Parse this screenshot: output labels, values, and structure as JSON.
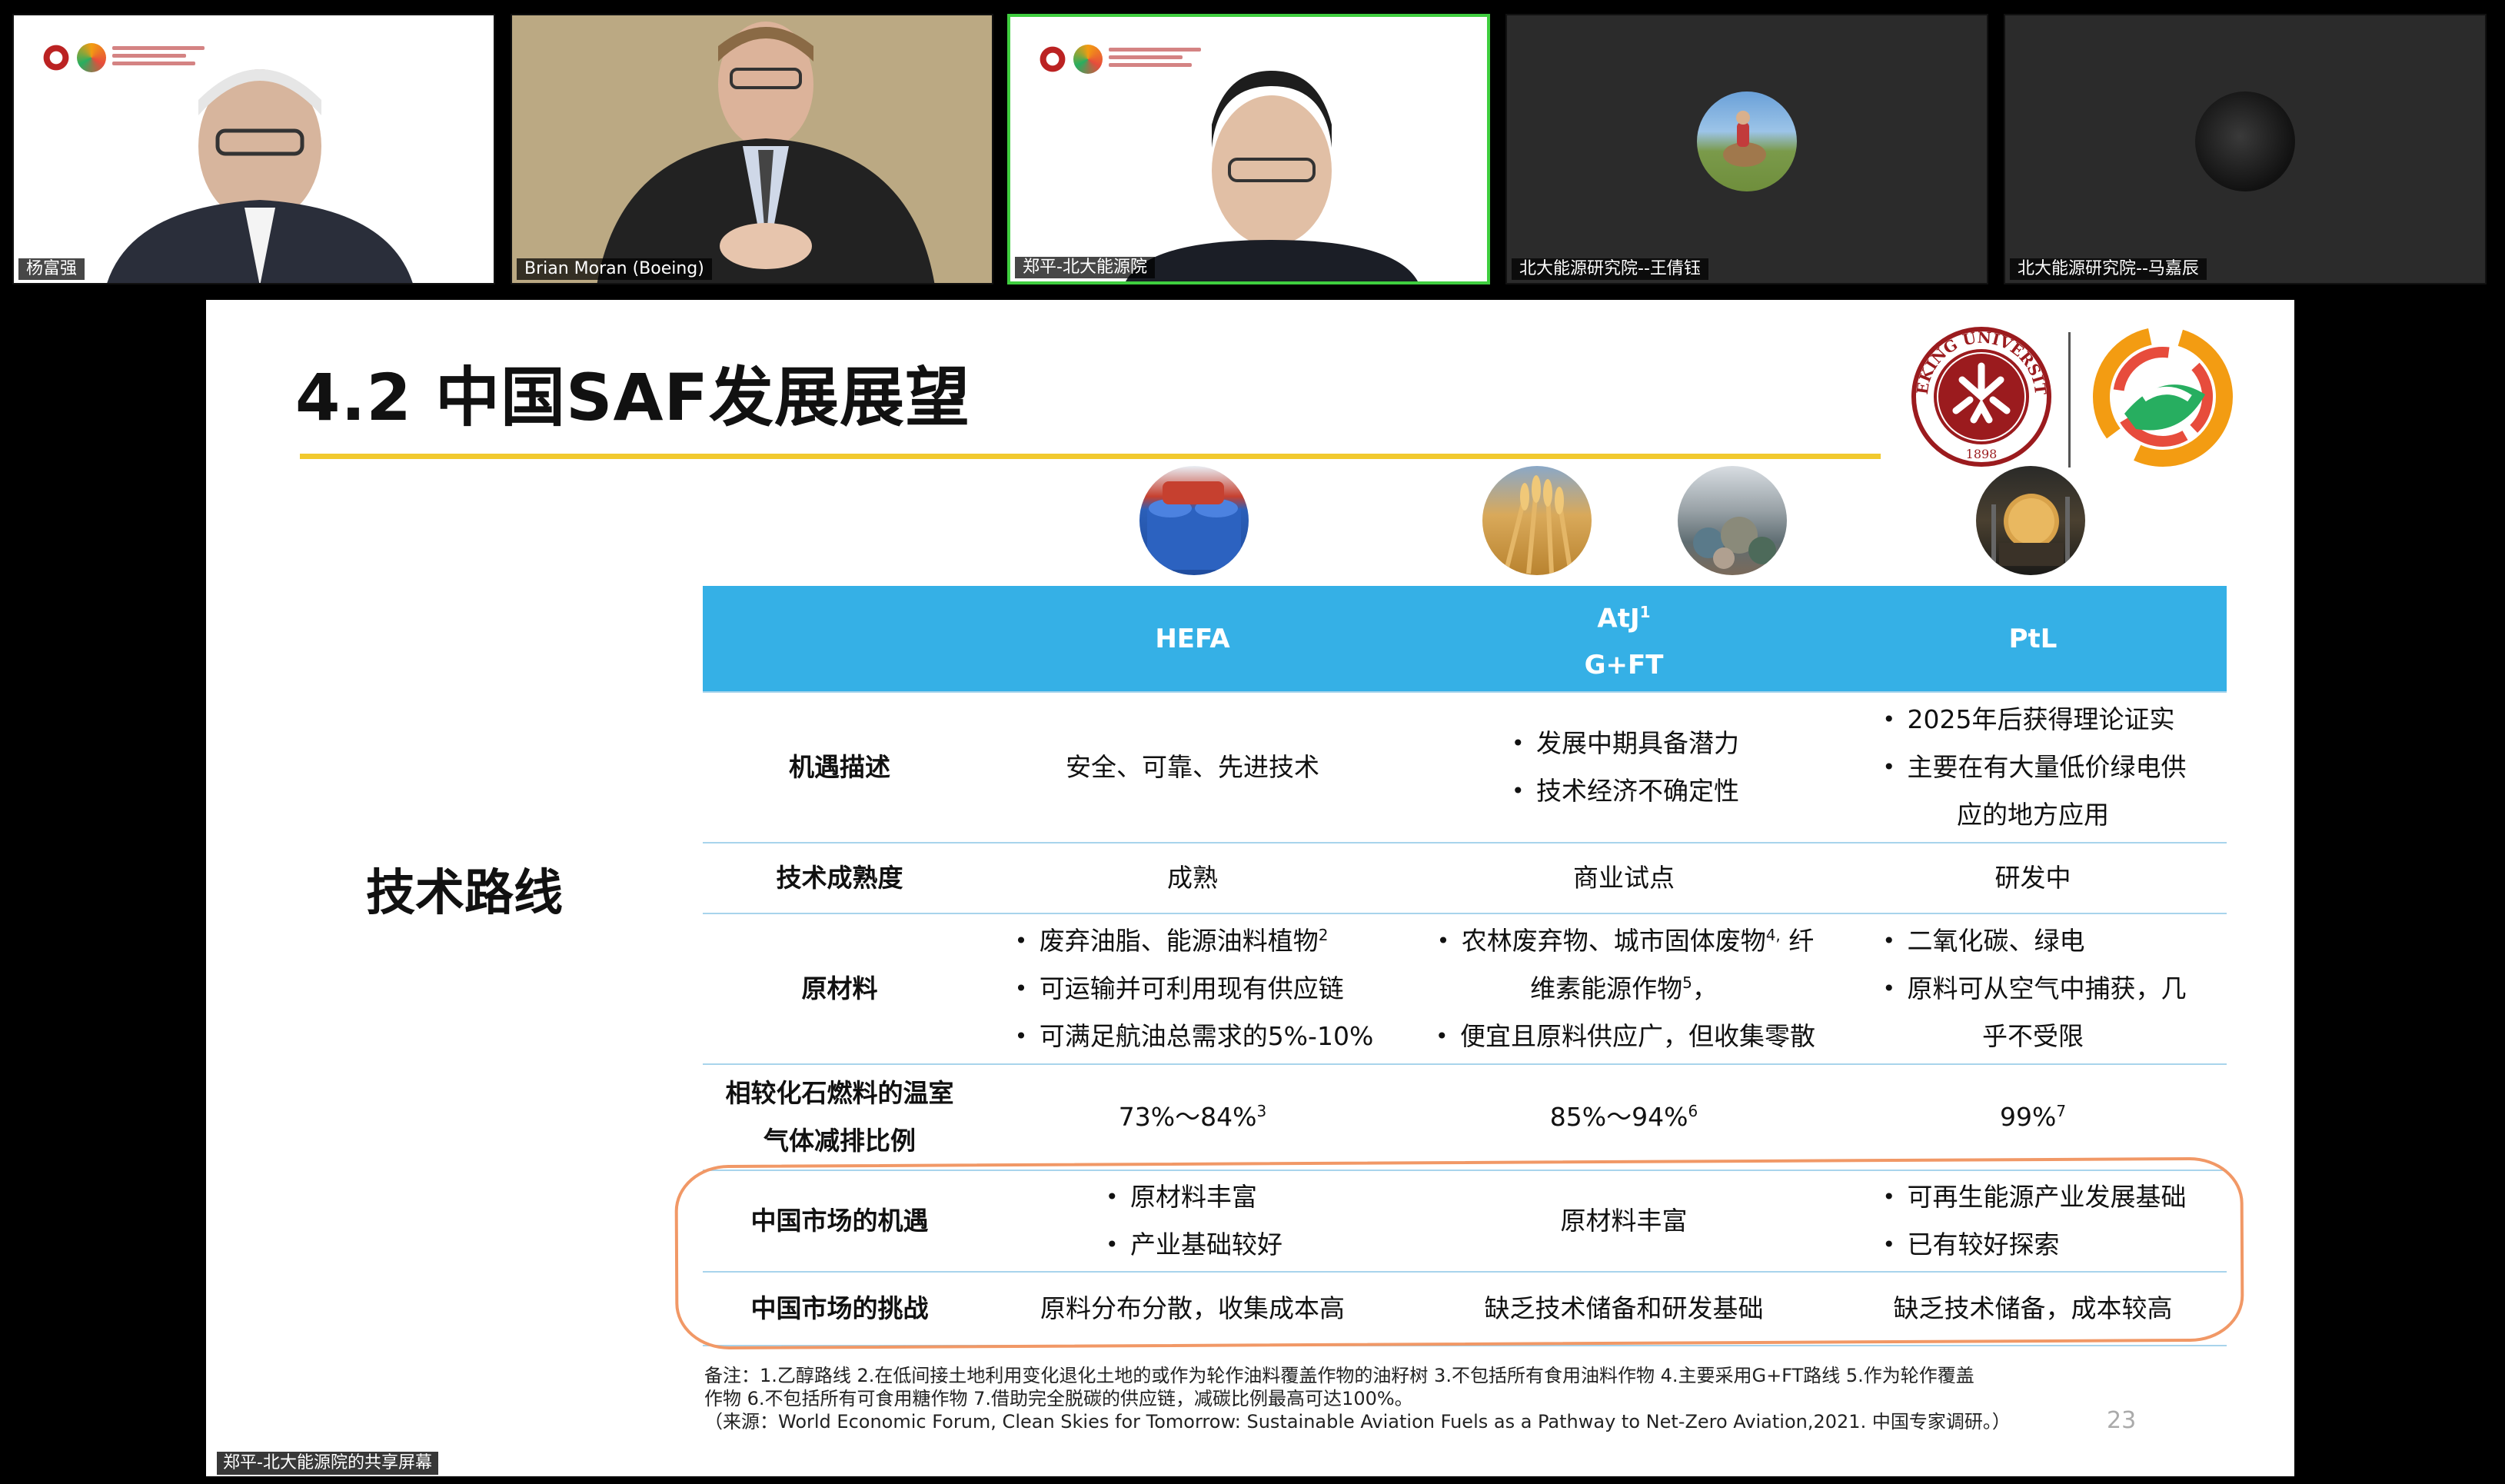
{
  "participants": [
    {
      "name": "杨富强",
      "background": "#ffffff",
      "avatar": "person-video"
    },
    {
      "name": "Brian Moran (Boeing)",
      "background": "#b9a98c",
      "avatar": "person-video"
    },
    {
      "name": "郑平-北大能源院",
      "background": "#ffffff",
      "avatar": "person-video",
      "active": true
    },
    {
      "name": "北大能源研究院--王倩钰",
      "background": "#2b2b2b",
      "avatar": "profile-photo"
    },
    {
      "name": "北大能源研究院--马嘉辰",
      "background": "#2b2b2b",
      "avatar": "profile-photo"
    }
  ],
  "slide": {
    "title": "4.2 中国SAF发展展望",
    "side_label": "技术路线",
    "page_number": "23",
    "table": {
      "headers": {
        "hefa": "HEFA",
        "atj_line1": "AtJ",
        "atj_sup": "1",
        "atj_line2": "G+FT",
        "ptl": "PtL"
      },
      "rows": {
        "opportunity": {
          "label": "机遇描述",
          "hefa": "安全、可靠、先进技术",
          "atj": [
            "发展中期具备潜力",
            "技术经济不确定性"
          ],
          "ptl": [
            "2025年后获得理论证实",
            "主要在有大量低价绿电供",
            "应的地方应用"
          ]
        },
        "maturity": {
          "label": "技术成熟度",
          "hefa": "成熟",
          "atj": "商业试点",
          "ptl": "研发中"
        },
        "feedstock": {
          "label": "原材料",
          "hefa": [
            "废弃油脂、能源油料植物",
            "可运输并可利用现有供应链",
            "可满足航油总需求的5%-10%"
          ],
          "hefa_sup": "2",
          "atj": [
            "农林废弃物、城市固体废物",
            "维素能源作物",
            "便宜且原料供应广，但收集零散"
          ],
          "atj_sup_a": "4,",
          "atj_tail_a": " 纤",
          "atj_sup_b": "5",
          "atj_tail_b": "，",
          "ptl": [
            "二氧化碳、绿电",
            "原料可从空气中捕获，几",
            "乎不受限"
          ]
        },
        "ghg": {
          "label_line1": "相较化石燃料的温室",
          "label_line2": "气体减排比例",
          "hefa": "73%～84%",
          "hefa_sup": "3",
          "atj": "85%～94%",
          "atj_sup": "6",
          "ptl": "99%",
          "ptl_sup": "7"
        },
        "china_opportunity": {
          "label": "中国市场的机遇",
          "hefa": [
            "原材料丰富",
            "产业基础较好"
          ],
          "atj": "原材料丰富",
          "ptl": [
            "可再生能源产业发展基础",
            "已有较好探索"
          ]
        },
        "china_challenge": {
          "label": "中国市场的挑战",
          "hefa": "原料分布分散，收集成本高",
          "atj": "缺乏技术储备和研发基础",
          "ptl": "缺乏技术储备，成本较高"
        }
      }
    },
    "footnote_line1": "备注：1.乙醇路线   2.在低间接土地利用变化退化土地的或作为轮作油料覆盖作物的油籽树   3.不包括所有食用油料作物  4.主要采用G+FT路线   5.作为轮作覆盖",
    "footnote_line2": "作物    6.不包括所有可食用糖作物   7.借助完全脱碳的供应链，减碳比例最高可达100%。",
    "footnote_line3": "（来源：World Economic Forum, Clean Skies for Tomorrow: Sustainable Aviation Fuels as a Pathway to Net-Zero Aviation,2021. 中国专家调研。）",
    "logo_seal_text": "PEKING UNIVERSITY 1898"
  },
  "share_label": "郑平-北大能源院的共享屏幕",
  "colors": {
    "header_blue": "#35b0e6",
    "title_rule": "#f1c92e",
    "highlight": "#f19866",
    "active_speaker": "#3fce3f",
    "pku_red": "#9b1b1e"
  }
}
